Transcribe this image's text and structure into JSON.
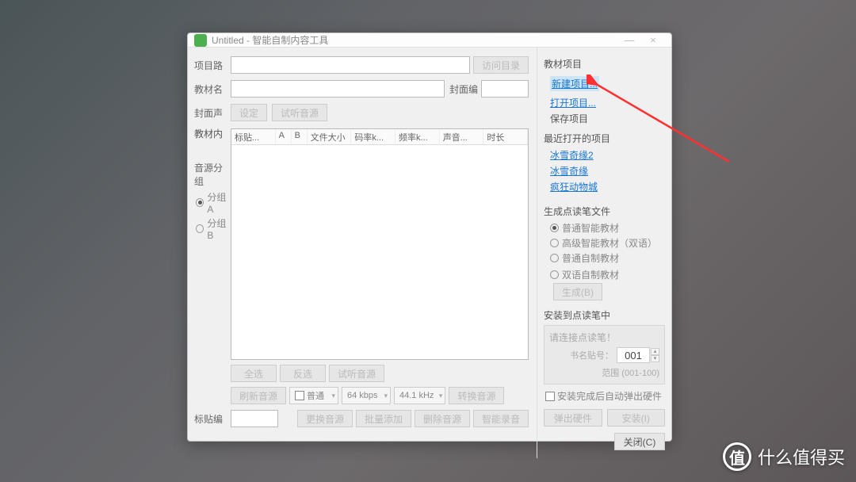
{
  "window": {
    "title": "Untitled - 智能自制内容工具",
    "min": "—",
    "close": "×"
  },
  "left": {
    "path_label": "项目路",
    "browse_btn": "访问目录",
    "name_label": "教材名",
    "cover_label": "封面编",
    "sound_label": "封面声",
    "set_btn": "设定",
    "preview_btn": "试听音源",
    "content_label": "教材内",
    "cols": [
      "标贴...",
      "A",
      "B",
      "文件大小",
      "码率k...",
      "频率k...",
      "声音...",
      "时长"
    ],
    "group_label": "音源分组",
    "group_a": "分组A",
    "group_b": "分组B",
    "select_all": "全选",
    "invert": "反选",
    "preview2": "试听音源",
    "refresh": "刷新音源",
    "normal": "普通",
    "bitrate": "64 kbps",
    "freq": "44.1 kHz",
    "convert": "转换音源",
    "sticker_label": "标贴编",
    "replace": "更换音源",
    "batch_add": "批量添加",
    "delete": "删除音源",
    "smart_rec": "智能录音"
  },
  "right": {
    "proj_header": "教材项目",
    "new_proj": "新建项目...",
    "open_proj": "打开项目...",
    "save_proj": "保存项目",
    "recent_header": "最近打开的项目",
    "recent": [
      "冰雪奇缘2",
      "冰雪奇缘",
      "疯狂动物城"
    ],
    "gen_header": "生成点读笔文件",
    "opt1": "普通智能教材",
    "opt2": "高级智能教材（双语）",
    "opt3": "普通自制教材",
    "opt4": "双语自制教材",
    "gen_btn": "生成(B)",
    "install_header": "安装到点读笔中",
    "connect_hint": "请连接点读笔！",
    "book_id_label": "书名贴号：",
    "range_label": "范围 (001-100)",
    "book_id_value": "001",
    "auto_eject": "安装完成后自动弹出硬件",
    "eject_btn": "弹出硬件",
    "install_btn": "安装(I)",
    "close_btn": "关闭(C)"
  },
  "watermark": "什么值得买"
}
